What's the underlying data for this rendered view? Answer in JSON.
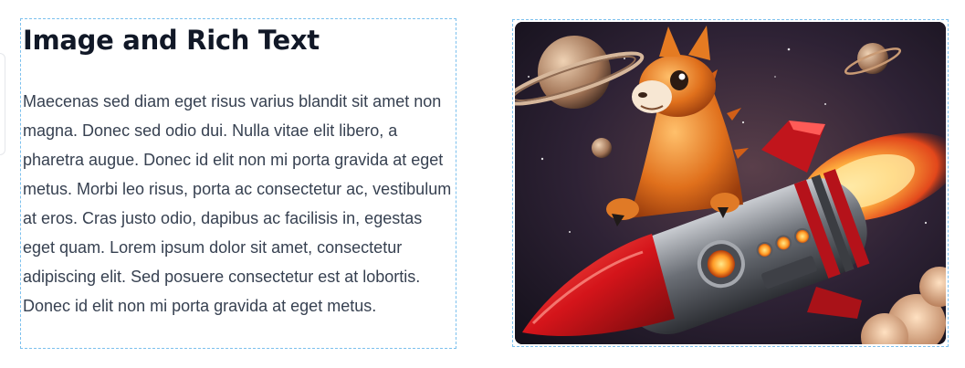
{
  "text_block": {
    "heading": "Image and Rich Text",
    "body": "Maecenas sed diam eget risus varius blandit sit amet non magna. Donec sed odio dui. Nulla vitae elit libero, a pharetra augue. Donec id elit non mi porta gravida at eget metus. Morbi leo risus, porta ac consectetur ac, vestibulum at eros. Cras justo odio, dapibus ac facilisis in, egestas eget quam. Lorem ipsum dolor sit amet, consectetur adipiscing elit. Sed posuere consectetur est at lobortis. Donec id elit non mi porta gravida at eget metus."
  },
  "image_block": {
    "icon": "llama-rocket-illustration"
  },
  "colors": {
    "selection_border": "#7cc0ee",
    "heading": "#111827",
    "body_text": "#374151"
  }
}
